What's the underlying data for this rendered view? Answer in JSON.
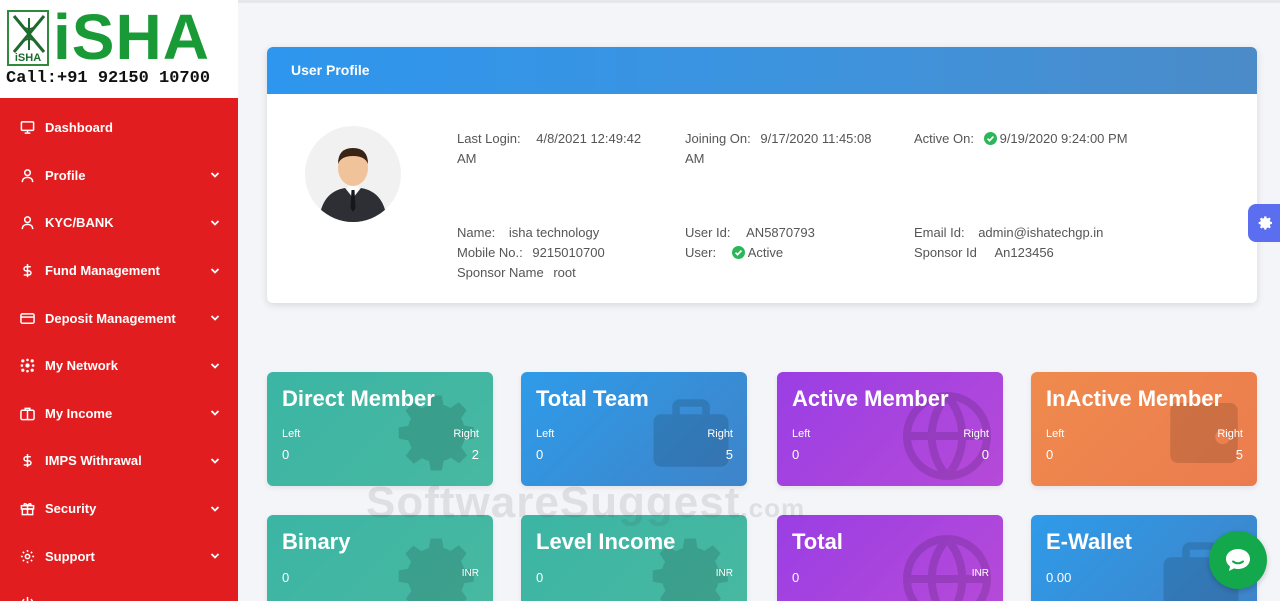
{
  "brand": {
    "emblem_text": "iSHA",
    "name": "iSHA",
    "call_line": "Call:+91 92150 10700"
  },
  "sidebar": {
    "items": [
      {
        "label": "Dashboard",
        "icon": "monitor-icon",
        "has_chevron": false
      },
      {
        "label": "Profile",
        "icon": "user-icon",
        "has_chevron": true
      },
      {
        "label": "KYC/BANK",
        "icon": "user-icon",
        "has_chevron": true
      },
      {
        "label": "Fund Management",
        "icon": "dollar-icon",
        "has_chevron": true
      },
      {
        "label": "Deposit Management",
        "icon": "credit-card-icon",
        "has_chevron": true
      },
      {
        "label": "My Network",
        "icon": "network-icon",
        "has_chevron": true
      },
      {
        "label": "My Income",
        "icon": "briefcase-icon",
        "has_chevron": true
      },
      {
        "label": "IMPS Withrawal",
        "icon": "dollar-icon",
        "has_chevron": true
      },
      {
        "label": "Security",
        "icon": "gift-icon",
        "has_chevron": true
      },
      {
        "label": "Support",
        "icon": "gear-icon",
        "has_chevron": true
      }
    ]
  },
  "profile": {
    "header": "User Profile",
    "last_login_key": "Last Login:",
    "last_login_val": "4/8/2021 12:49:42",
    "last_login_val2": "AM",
    "joining_key": "Joining On:",
    "joining_val": "9/17/2020 11:45:08",
    "joining_val2": "AM",
    "active_key": "Active On:",
    "active_val": "9/19/2020 9:24:00 PM",
    "name_key": "Name:",
    "name_val": "isha technology",
    "mobile_key": "Mobile No.:",
    "mobile_val": "9215010700",
    "sponsor_name_key": "Sponsor Name",
    "sponsor_name_val": "root",
    "userid_key": "User Id:",
    "userid_val": "AN5870793",
    "user_key": "User:",
    "user_val": "Active",
    "email_key": "Email Id:",
    "email_val": "admin@ishatechgp.in",
    "sponsor_id_key": "Sponsor Id",
    "sponsor_id_val": "An123456"
  },
  "stats": [
    {
      "title": "Direct Member",
      "left_label": "Left",
      "right_label": "Right",
      "left_value": "0",
      "right_value": "2",
      "color": "#3bb5a4",
      "icon": "gear-icon"
    },
    {
      "title": "Total Team",
      "left_label": "Left",
      "right_label": "Right",
      "left_value": "0",
      "right_value": "5",
      "color": "#2e9be9",
      "icon": "briefcase-icon"
    },
    {
      "title": "Active Member",
      "left_label": "Left",
      "right_label": "Right",
      "left_value": "0",
      "right_value": "0",
      "color": "#9a3ee4",
      "icon": "globe-icon"
    },
    {
      "title": "InActive Member",
      "left_label": "Left",
      "right_label": "Right",
      "left_value": "0",
      "right_value": "5",
      "color": "#ef8a4d",
      "icon": "wallet-icon"
    }
  ],
  "income": [
    {
      "title": "Binary",
      "value": "0",
      "unit": "INR",
      "color": "#3bb5a4",
      "icon": "gear-icon"
    },
    {
      "title": "Level Income",
      "value": "0",
      "unit": "INR",
      "color": "#3bb5a4",
      "icon": "gear-icon"
    },
    {
      "title": "Total",
      "value": "0",
      "unit": "INR",
      "color": "#9a3ee4",
      "icon": "globe-icon"
    },
    {
      "title": "E-Wallet",
      "value": "0.00",
      "unit": "",
      "color": "#2e9be9",
      "icon": "briefcase-icon"
    }
  ],
  "watermark": {
    "main": "SoftwareSuggest",
    "suffix": ".com"
  }
}
